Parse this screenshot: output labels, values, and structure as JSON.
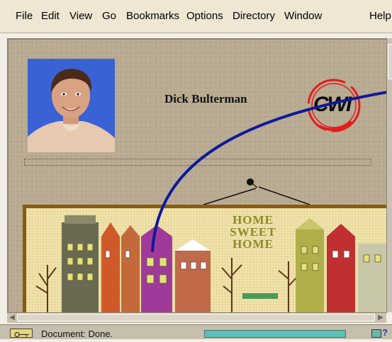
{
  "menubar": {
    "items": [
      {
        "label": "File"
      },
      {
        "label": "Edit"
      },
      {
        "label": "View"
      },
      {
        "label": "Go"
      },
      {
        "label": "Bookmarks"
      },
      {
        "label": "Options"
      },
      {
        "label": "Directory"
      },
      {
        "label": "Window"
      },
      {
        "label": "Help"
      }
    ]
  },
  "page": {
    "person_name": "Dick Bulterman",
    "logo_text": "CWI",
    "sampler_text": [
      "HOME",
      "SWEET",
      "HOME"
    ]
  },
  "colors": {
    "page_background": "#b9ab92",
    "link_curve": "#0d1a9a",
    "logo_red": "#e21c1c",
    "frame_brown": "#8a5a12",
    "progress_teal": "#5bc0b8"
  },
  "icons": {
    "status": "security-key-icon",
    "mail": "mail-icon",
    "help": "question-mark-icon"
  },
  "statusbar": {
    "text": "Document: Done.",
    "help_glyph": "?"
  }
}
